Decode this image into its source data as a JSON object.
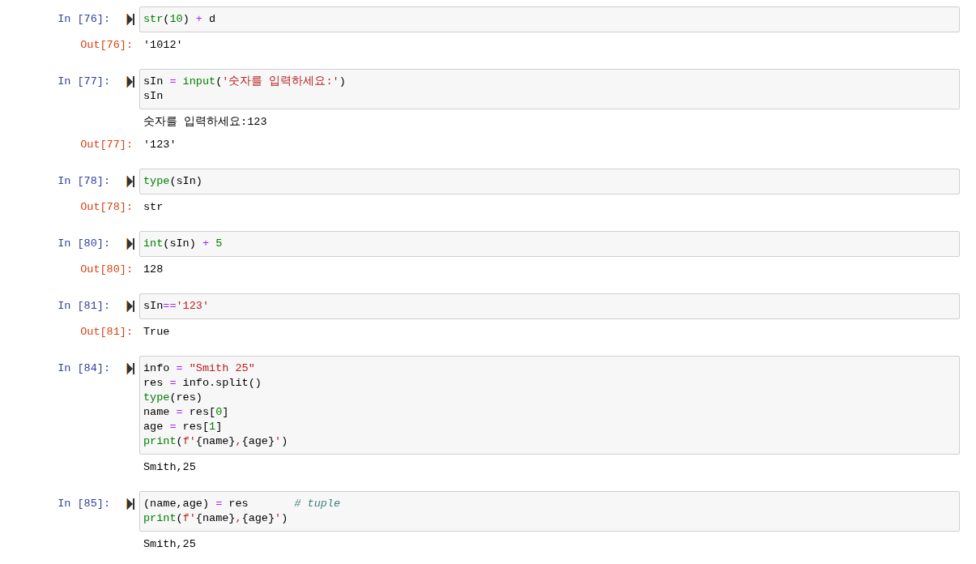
{
  "cells": [
    {
      "prompt": "In [76]:",
      "lines": [
        [
          {
            "kind": "builtin",
            "text": "str"
          },
          {
            "kind": "plain",
            "text": "("
          },
          {
            "kind": "number",
            "text": "10"
          },
          {
            "kind": "plain",
            "text": ") "
          },
          {
            "kind": "operator",
            "text": "+"
          },
          {
            "kind": "plain",
            "text": " d"
          }
        ]
      ],
      "outputs": [
        {
          "kind": "result",
          "prompt": "Out[76]:",
          "text": "'1012'"
        }
      ]
    },
    {
      "prompt": "In [77]:",
      "lines": [
        [
          {
            "kind": "plain",
            "text": "sIn "
          },
          {
            "kind": "operator",
            "text": "= "
          },
          {
            "kind": "builtin",
            "text": "input"
          },
          {
            "kind": "plain",
            "text": "("
          },
          {
            "kind": "string",
            "text": "'숫자를 입력하세요:'"
          },
          {
            "kind": "plain",
            "text": ")"
          }
        ],
        [
          {
            "kind": "plain",
            "text": "sIn"
          }
        ]
      ],
      "outputs": [
        {
          "kind": "stream",
          "text": "숫자를 입력하세요:123"
        },
        {
          "kind": "result",
          "prompt": "Out[77]:",
          "text": "'123'"
        }
      ]
    },
    {
      "prompt": "In [78]:",
      "lines": [
        [
          {
            "kind": "builtin",
            "text": "type"
          },
          {
            "kind": "plain",
            "text": "(sIn)"
          }
        ]
      ],
      "outputs": [
        {
          "kind": "result",
          "prompt": "Out[78]:",
          "text": "str"
        }
      ]
    },
    {
      "prompt": "In [80]:",
      "lines": [
        [
          {
            "kind": "builtin",
            "text": "int"
          },
          {
            "kind": "plain",
            "text": "(sIn) "
          },
          {
            "kind": "operator",
            "text": "+ "
          },
          {
            "kind": "number",
            "text": "5"
          }
        ]
      ],
      "outputs": [
        {
          "kind": "result",
          "prompt": "Out[80]:",
          "text": "128"
        }
      ]
    },
    {
      "prompt": "In [81]:",
      "lines": [
        [
          {
            "kind": "plain",
            "text": "sIn"
          },
          {
            "kind": "operator",
            "text": "=="
          },
          {
            "kind": "string",
            "text": "'123'"
          }
        ]
      ],
      "outputs": [
        {
          "kind": "result",
          "prompt": "Out[81]:",
          "text": "True"
        }
      ]
    },
    {
      "prompt": "In [84]:",
      "lines": [
        [
          {
            "kind": "plain",
            "text": "info "
          },
          {
            "kind": "operator",
            "text": "= "
          },
          {
            "kind": "string",
            "text": "\"Smith 25\""
          }
        ],
        [
          {
            "kind": "plain",
            "text": "res "
          },
          {
            "kind": "operator",
            "text": "="
          },
          {
            "kind": "plain",
            "text": " info.split()"
          }
        ],
        [
          {
            "kind": "builtin",
            "text": "type"
          },
          {
            "kind": "plain",
            "text": "(res)"
          }
        ],
        [
          {
            "kind": "plain",
            "text": "name "
          },
          {
            "kind": "operator",
            "text": "="
          },
          {
            "kind": "plain",
            "text": " res["
          },
          {
            "kind": "number",
            "text": "0"
          },
          {
            "kind": "plain",
            "text": "]"
          }
        ],
        [
          {
            "kind": "plain",
            "text": "age "
          },
          {
            "kind": "operator",
            "text": "="
          },
          {
            "kind": "plain",
            "text": " res["
          },
          {
            "kind": "number",
            "text": "1"
          },
          {
            "kind": "plain",
            "text": "]"
          }
        ],
        [
          {
            "kind": "builtin",
            "text": "print"
          },
          {
            "kind": "plain",
            "text": "("
          },
          {
            "kind": "string",
            "text": "f'"
          },
          {
            "kind": "plain",
            "text": "{name}"
          },
          {
            "kind": "string",
            "text": ","
          },
          {
            "kind": "plain",
            "text": "{age}"
          },
          {
            "kind": "string",
            "text": "'"
          },
          {
            "kind": "plain",
            "text": ")"
          }
        ]
      ],
      "outputs": [
        {
          "kind": "stream",
          "text": "Smith,25"
        }
      ]
    },
    {
      "prompt": "In [85]:",
      "lines": [
        [
          {
            "kind": "plain",
            "text": "(name,age) "
          },
          {
            "kind": "operator",
            "text": "="
          },
          {
            "kind": "plain",
            "text": " res       "
          },
          {
            "kind": "comment",
            "text": "# tuple"
          }
        ],
        [
          {
            "kind": "builtin",
            "text": "print"
          },
          {
            "kind": "plain",
            "text": "("
          },
          {
            "kind": "string",
            "text": "f'"
          },
          {
            "kind": "plain",
            "text": "{name}"
          },
          {
            "kind": "string",
            "text": ","
          },
          {
            "kind": "plain",
            "text": "{age}"
          },
          {
            "kind": "string",
            "text": "'"
          },
          {
            "kind": "plain",
            "text": ")"
          }
        ]
      ],
      "outputs": [
        {
          "kind": "stream",
          "text": "Smith,25"
        }
      ]
    }
  ]
}
